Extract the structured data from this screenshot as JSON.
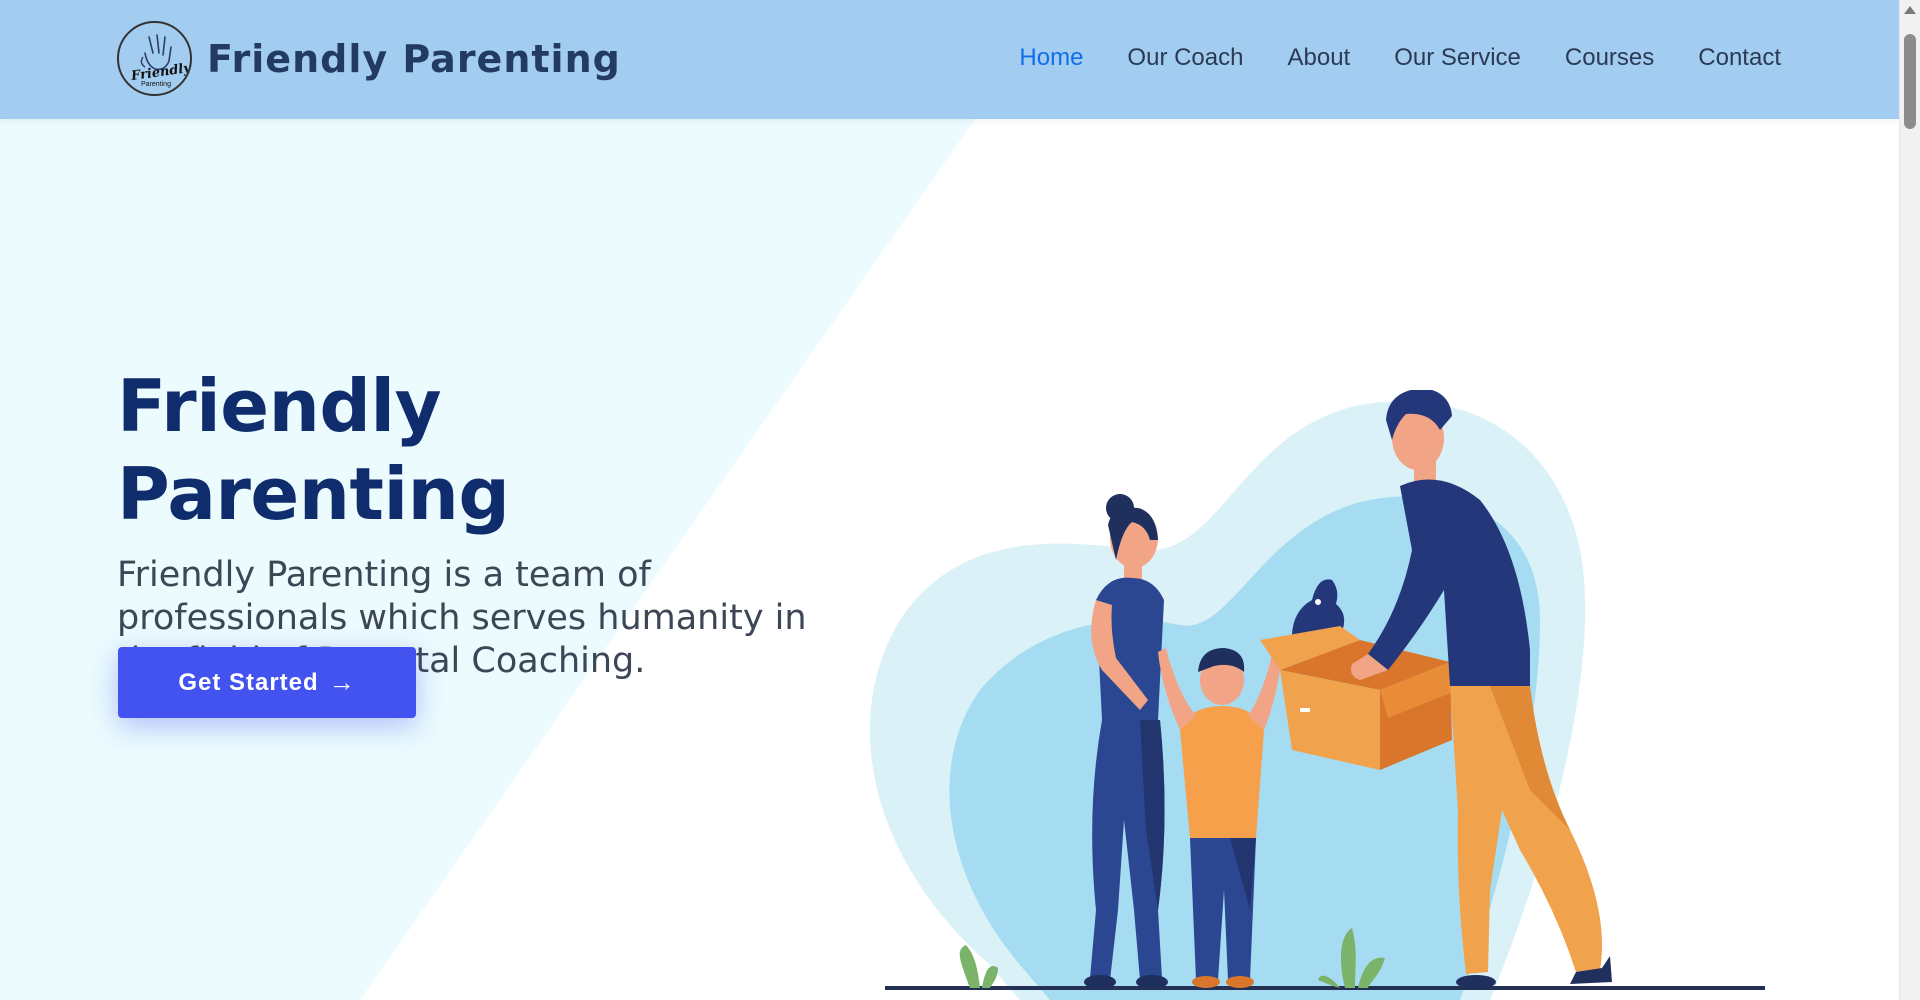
{
  "brand": {
    "name": "Friendly Parenting",
    "logo_text": "Friendly",
    "logo_subtext": "Parenting"
  },
  "nav": {
    "items": [
      {
        "label": "Home",
        "active": true
      },
      {
        "label": "Our Coach",
        "active": false
      },
      {
        "label": "About",
        "active": false
      },
      {
        "label": "Our Service",
        "active": false
      },
      {
        "label": "Courses",
        "active": false
      },
      {
        "label": "Contact",
        "active": false
      }
    ]
  },
  "hero": {
    "title": "Friendly Parenting",
    "description": "Friendly Parenting is a team of professionals which serves humanity in the field of Parental Coaching.",
    "cta_label": "Get Started",
    "cta_icon": "arrow-right-icon"
  },
  "colors": {
    "header_bg": "#a3cdf0",
    "nav_active": "#106eea",
    "title": "#0f2c6d",
    "cta": "#4353f0",
    "hero_panel": "#ebfbfe"
  }
}
